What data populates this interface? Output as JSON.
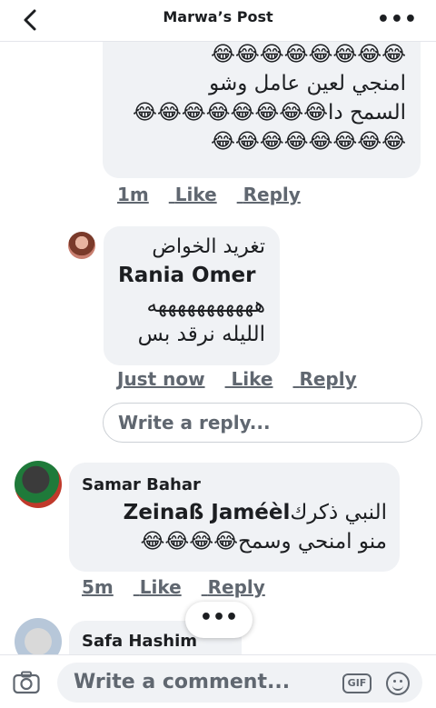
{
  "header": {
    "title": "Marwa’s Post",
    "more_label": "•••"
  },
  "comments": [
    {
      "lines": [
        "😂😂😂😂😂😂😂😂",
        "امنجي لعين عامل وشو",
        "السمح دا😂😂😂😂😂😂😂😂",
        "😂😂😂😂😂😂😂😂"
      ],
      "time": "1m",
      "like": "Like",
      "reply": "Reply"
    },
    {
      "author": "تغريد الخواض",
      "tag": "Rania Omer",
      "lines": [
        "هههههههههههه",
        "الليله نرقد بس"
      ],
      "time": "Just now",
      "like": "Like",
      "reply": "Reply"
    },
    {
      "author": "Samar Bahar",
      "tag": "Zeinaß Jaméèl",
      "line1_after_tag": "النبي ذكرك",
      "line2": "منو امنحي وسمح😂😂😂😂",
      "time": "5m",
      "like": "Like",
      "reply": "Reply"
    },
    {
      "author": "Safa Hashim"
    }
  ],
  "reply_box": {
    "placeholder": "Write a reply..."
  },
  "more_replies": "•••",
  "composer": {
    "placeholder": "Write a comment...",
    "gif_label": "GIF"
  }
}
